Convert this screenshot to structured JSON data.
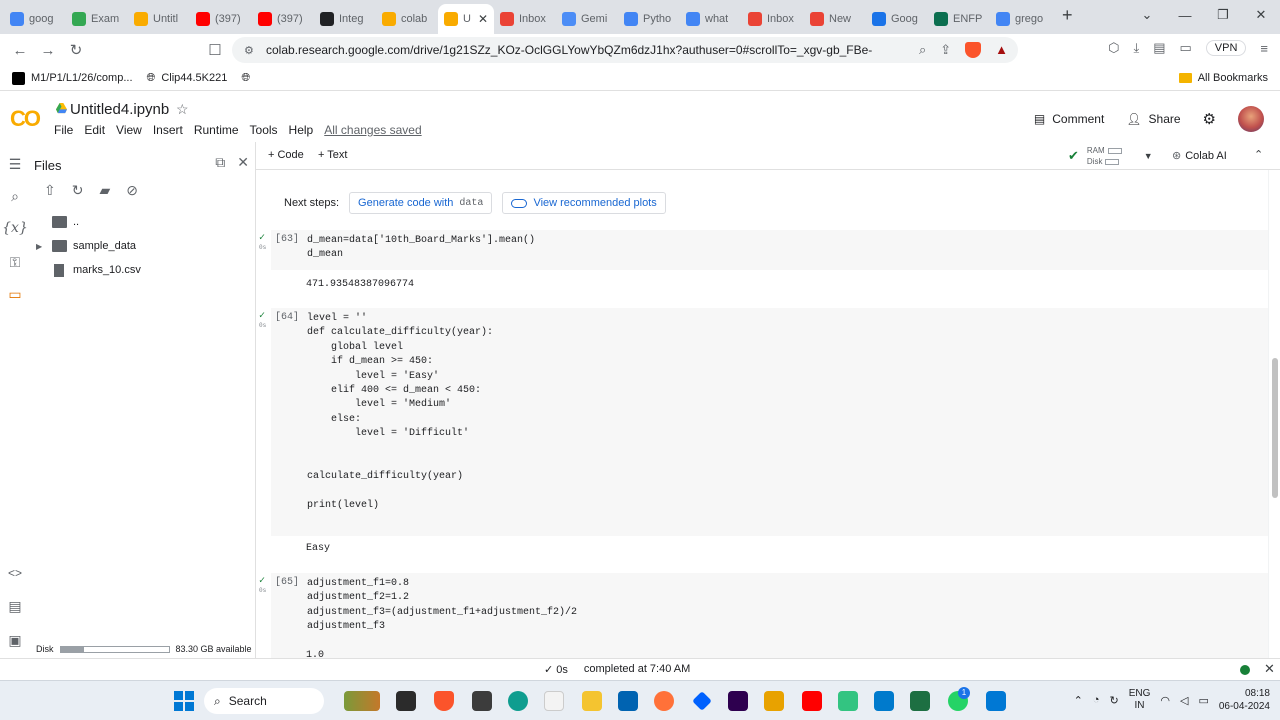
{
  "browser": {
    "tabs": [
      {
        "title": "goog",
        "icon": "google-icon",
        "color": "#4285f4"
      },
      {
        "title": "Exam",
        "icon": "exam-icon",
        "color": "#34a853"
      },
      {
        "title": "Untitl",
        "icon": "colab-icon",
        "color": "#f9ab00"
      },
      {
        "title": "(397)",
        "icon": "youtube-icon",
        "color": "#ff0000"
      },
      {
        "title": "(397)",
        "icon": "youtube-icon",
        "color": "#ff0000"
      },
      {
        "title": "Integ",
        "icon": "integ-icon",
        "color": "#202124"
      },
      {
        "title": "colab",
        "icon": "colab-icon",
        "color": "#f9ab00"
      },
      {
        "title": "U",
        "icon": "colab-icon",
        "color": "#f9ab00",
        "active": true
      },
      {
        "title": "Inbox",
        "icon": "gmail-icon",
        "color": "#ea4335"
      },
      {
        "title": "Gemi",
        "icon": "gemini-icon",
        "color": "#4c8df6"
      },
      {
        "title": "Pytho",
        "icon": "python-icon",
        "color": "#4285f4"
      },
      {
        "title": "what",
        "icon": "google-icon",
        "color": "#4285f4"
      },
      {
        "title": "Inbox",
        "icon": "gmail-icon",
        "color": "#ea4335"
      },
      {
        "title": "New",
        "icon": "gmail-icon",
        "color": "#ea4335"
      },
      {
        "title": "Goog",
        "icon": "classroom-icon",
        "color": "#1a73e8"
      },
      {
        "title": "ENFP",
        "icon": "v-icon",
        "color": "#0b6e4f"
      },
      {
        "title": "grego",
        "icon": "google-icon",
        "color": "#4285f4"
      }
    ],
    "close_glyph": "✕",
    "url": "colab.research.google.com/drive/1g21SZz_KOz-OclGGLYowYbQZm6dzJ1hx?authuser=0#scrollTo=_xgv-gb_FBe-",
    "vpn_label": "VPN",
    "bookmarks": [
      {
        "label": "M1/P1/L1/26/comp...",
        "icon": "bookmark-m-icon",
        "color": "#000000"
      },
      {
        "label": "Clip44.5K221",
        "icon": "globe-icon",
        "color": "#202124"
      },
      {
        "label": "",
        "icon": "globe-icon",
        "color": "#202124"
      }
    ],
    "all_bookmarks": "All Bookmarks"
  },
  "colab": {
    "notebook_title": "Untitled4.ipynb",
    "menu": [
      "File",
      "Edit",
      "View",
      "Insert",
      "Runtime",
      "Tools",
      "Help"
    ],
    "saved_status": "All changes saved",
    "comment_label": "Comment",
    "share_label": "Share",
    "toolbar": {
      "add_code": "+ Code",
      "add_text": "+ Text",
      "ram_label": "RAM",
      "disk_label": "Disk",
      "colab_ai": "Colab AI"
    }
  },
  "files_panel": {
    "title": "Files",
    "items": [
      {
        "label": "..",
        "kind": "folder"
      },
      {
        "label": "sample_data",
        "kind": "folder"
      },
      {
        "label": "marks_10.csv",
        "kind": "file"
      }
    ],
    "disk_label": "Disk",
    "disk_available": "83.30 GB available",
    "disk_used_fraction": 0.22
  },
  "notebook": {
    "next_steps_label": "Next steps:",
    "generate_code_label": "Generate code with",
    "generate_code_var": "data",
    "recommended_plots_label": "View recommended plots",
    "cells": [
      {
        "number": "[63]",
        "code": [
          "d_mean=data['10th_Board_Marks'].mean()",
          "d_mean"
        ],
        "output": "471.93548387096774"
      },
      {
        "number": "[64]",
        "code": [
          "level = ''",
          "def calculate_difficulty(year):",
          "    global level",
          "    if d_mean >= 450:",
          "        level = 'Easy'",
          "    elif 400 <= d_mean < 450:",
          "        level = 'Medium'",
          "    else:",
          "        level = 'Difficult'",
          "",
          "",
          "calculate_difficulty(year)",
          "",
          "print(level)"
        ],
        "output": "Easy"
      },
      {
        "number": "[65]",
        "code": [
          "adjustment_f1=0.8",
          "adjustment_f2=1.2",
          "adjustment_f3=(adjustment_f1+adjustment_f2)/2",
          "adjustment_f3"
        ],
        "output": "1.0"
      }
    ],
    "exec_time": "0s"
  },
  "status_bar": {
    "check": "✓ 0s",
    "completed": "completed at 7:40 AM"
  },
  "taskbar": {
    "search_label": "Search",
    "lang_line1": "ENG",
    "lang_line2": "IN",
    "time": "08:18",
    "date": "06-04-2024",
    "whatsapp_badge": "1"
  }
}
